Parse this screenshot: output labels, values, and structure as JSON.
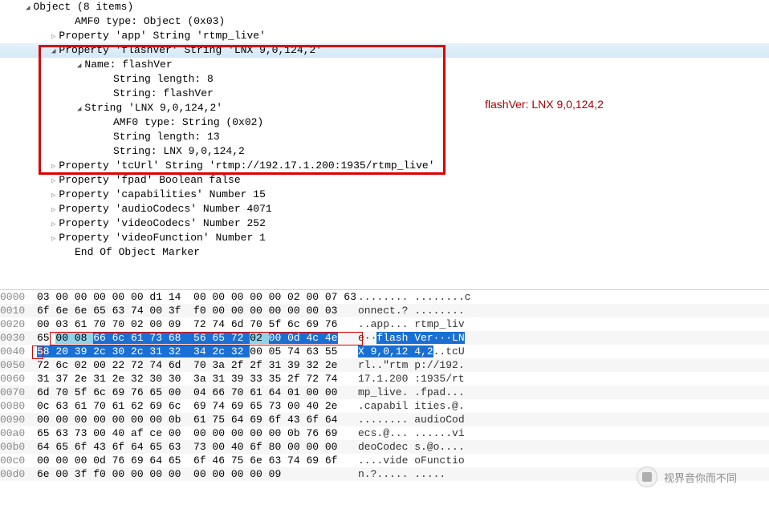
{
  "tree": {
    "root": "Object (8 items)",
    "amf0": "AMF0 type: Object (0x03)",
    "prop_app": "Property 'app' String 'rtmp_live'",
    "prop_flashver": "Property 'flashVer' String 'LNX 9,0,124,2'",
    "name_flashver": "Name: flashVer",
    "strlen8": "String length: 8",
    "str_flashver": "String: flashVer",
    "str_lnx": "String 'LNX 9,0,124,2'",
    "amf_str": "AMF0 type: String (0x02)",
    "strlen13": "String length: 13",
    "str_val": "String: LNX 9,0,124,2",
    "prop_tcurl": "Property 'tcUrl' String 'rtmp://192.17.1.200:1935/rtmp_live'",
    "prop_fpad": "Property 'fpad' Boolean false",
    "prop_cap": "Property 'capabilities' Number 15",
    "prop_ac": "Property 'audioCodecs' Number 4071",
    "prop_vc": "Property 'videoCodecs' Number 252",
    "prop_vf": "Property 'videoFunction' Number 1",
    "eom": "End Of Object Marker"
  },
  "annotation": "flashVer: LNX 9,0,124,2",
  "hex": [
    {
      "off": "0000",
      "b1": "03 00 00 00 00 00 d1 14",
      "b2": "  00 00 00 00 00 02 00 07 63",
      "a": "........ ........c"
    },
    {
      "off": "0010",
      "b1": "6f 6e 6e 65 63 74 00 3f",
      "b2": "  f0 00 00 00 00 00 00 03",
      "a": "onnect.? ........"
    },
    {
      "off": "0020",
      "b1": "00 03 61 70 70 02 00 09",
      "b2": "  72 74 6d 70 5f 6c 69 76",
      "a": "..app... rtmp_liv"
    },
    {
      "off": "0030",
      "b1": "65 ",
      "hl_cyan": "00 08 ",
      "hl_blue": "66 6c 61 73 68",
      "b2hl": "  56 65 72 ",
      "hl_cyan2": "02 ",
      "hl_blue2": "00 0d ",
      "hl_blue3": "4c 4e",
      "a_pre": "e··",
      "a_hl": "flash Ver···",
      "a_hl2": "LN"
    },
    {
      "off": "0040",
      "hl_blue": "58 20 39 2c 30 2c 31 32",
      "b2hl": "  34 2c 32 ",
      "b2": "00 05 74 63 55",
      "a_hl": "X 9,0,12 4,2",
      "a": "..tcU"
    },
    {
      "off": "0050",
      "b1": "72 6c 02 00 22 72 74 6d",
      "b2": "  70 3a 2f 2f 31 39 32 2e",
      "a": "rl..\"rtm p://192."
    },
    {
      "off": "0060",
      "b1": "31 37 2e 31 2e 32 30 30",
      "b2": "  3a 31 39 33 35 2f 72 74",
      "a": "17.1.200 :1935/rt"
    },
    {
      "off": "0070",
      "b1": "6d 70 5f 6c 69 76 65 00",
      "b2": "  04 66 70 61 64 01 00 00",
      "a": "mp_live. .fpad..."
    },
    {
      "off": "0080",
      "b1": "0c 63 61 70 61 62 69 6c",
      "b2": "  69 74 69 65 73 00 40 2e",
      "a": ".capabil ities.@."
    },
    {
      "off": "0090",
      "b1": "00 00 00 00 00 00 00 0b",
      "b2": "  61 75 64 69 6f 43 6f 64",
      "a": "........ audioCod"
    },
    {
      "off": "00a0",
      "b1": "65 63 73 00 40 af ce 00",
      "b2": "  00 00 00 00 00 0b 76 69",
      "a": "ecs.@... ......vi"
    },
    {
      "off": "00b0",
      "b1": "64 65 6f 43 6f 64 65 63",
      "b2": "  73 00 40 6f 80 00 00 00",
      "a": "deoCodec s.@o...."
    },
    {
      "off": "00c0",
      "b1": "00 00 00 0d 76 69 64 65",
      "b2": "  6f 46 75 6e 63 74 69 6f",
      "a": "....vide oFunctio"
    },
    {
      "off": "00d0",
      "b1": "6e 00 3f f0 00 00 00 00",
      "b2": "  00 00 00 00 09",
      "a": "n.?..... ....."
    }
  ],
  "watermark": "视界音你而不同"
}
